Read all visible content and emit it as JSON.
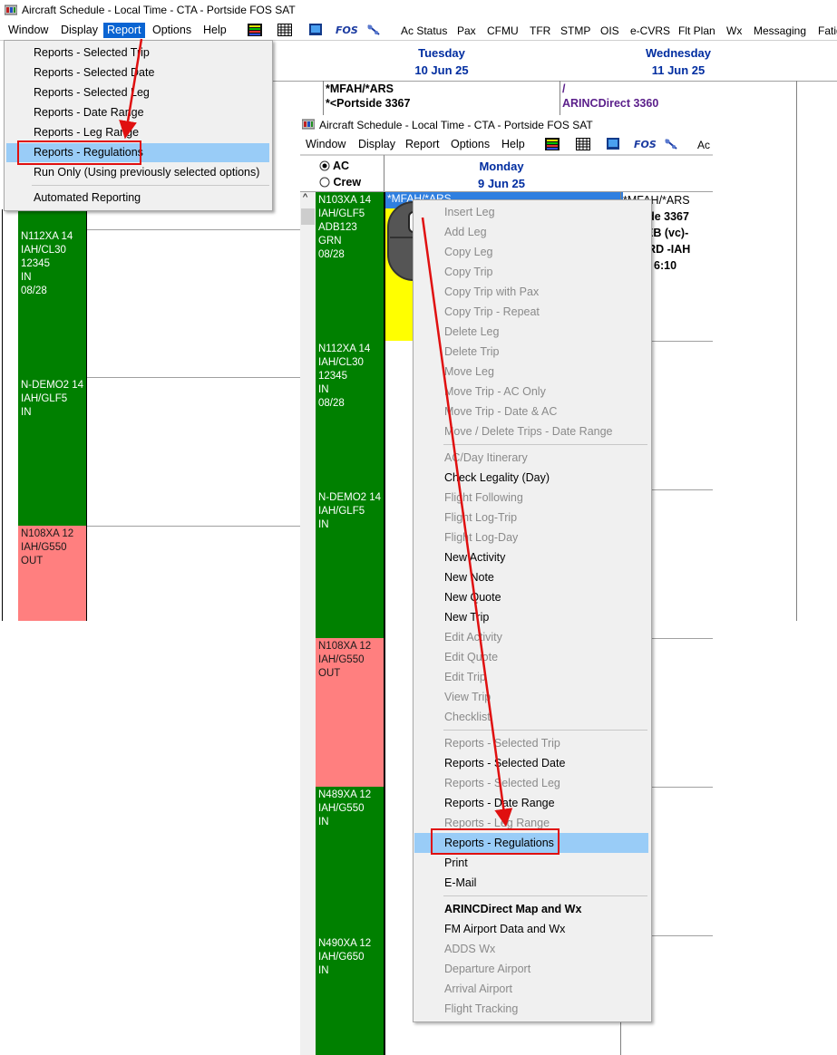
{
  "window": {
    "title": "Aircraft Schedule - Local Time - CTA - Portside FOS SAT"
  },
  "menubar": {
    "items": [
      "Window",
      "Display",
      "Report",
      "Options",
      "Help"
    ],
    "fos_label": "FOS",
    "toolbar_items": [
      "Ac Status",
      "Pax",
      "CFMU",
      "TFR",
      "STMP",
      "OIS",
      "e-CVRS",
      "Flt Plan",
      "Wx",
      "Messaging",
      "Fatig"
    ]
  },
  "schedule": {
    "days": [
      {
        "day": "Tuesday",
        "date": "10 Jun 25"
      },
      {
        "day": "Wednesday",
        "date": "11 Jun 25"
      }
    ],
    "trip_row": {
      "cell1_line1": "*MFAH/*ARS",
      "cell1_line2": "*<Portside 3367",
      "cell2_line1": "/",
      "cell2_line2": "ARINCDirect 3360"
    },
    "aircraft": [
      {
        "text": "N112XA 14\nIAH/CL30\n12345\nIN\n08/28"
      },
      {
        "text": "N-DEMO2 14\nIAH/GLF5\nIN"
      },
      {
        "text": "N108XA 12\nIAH/G550\nOUT"
      }
    ]
  },
  "report_menu": {
    "items": [
      "Reports - Selected Trip",
      "Reports - Selected Date",
      "Reports - Selected Leg",
      "Reports - Date Range",
      "Reports - Leg Range",
      "Reports - Regulations",
      "Run Only (Using previously selected options)",
      "Automated Reporting"
    ],
    "highlighted": "Reports - Regulations"
  },
  "inner_window": {
    "title": "Aircraft Schedule - Local Time - CTA - Portside FOS SAT",
    "menu": [
      "Window",
      "Display",
      "Report",
      "Options",
      "Help"
    ],
    "fos_label": "FOS",
    "partial_item": "Ac",
    "radio_ac": "AC",
    "radio_crew": "Crew",
    "scroll_up": "^",
    "day": "Monday",
    "date": "9 Jun 25",
    "selected_cell": "*MFAH/*ARS",
    "right_lines": [
      "*MFAH/*ARS",
      "ortside 3367",
      "00 TEB (vc)-",
      "26 ORD -IAH",
      "10 Dt 6:10"
    ],
    "aircraft": [
      {
        "text": "N103XA 14\nIAH/GLF5\nADB123\nGRN\n08/28",
        "color": "green"
      },
      {
        "text": "N112XA 14\nIAH/CL30\n12345\nIN\n08/28",
        "color": "green"
      },
      {
        "text": "N-DEMO2 14\nIAH/GLF5\nIN",
        "color": "green"
      },
      {
        "text": "N108XA 12\nIAH/G550\nOUT",
        "color": "red"
      },
      {
        "text": "N489XA 12\nIAH/G550\nIN",
        "color": "green"
      },
      {
        "text": "N490XA 12\nIAH/G650\nIN",
        "color": "green"
      }
    ]
  },
  "context_menu": {
    "items": [
      {
        "label": "Insert Leg",
        "enabled": false
      },
      {
        "label": "Add Leg",
        "enabled": false
      },
      {
        "label": "Copy Leg",
        "enabled": false
      },
      {
        "label": "Copy Trip",
        "enabled": false
      },
      {
        "label": "Copy Trip with Pax",
        "enabled": false
      },
      {
        "label": "Copy Trip - Repeat",
        "enabled": false
      },
      {
        "label": "Delete Leg",
        "enabled": false
      },
      {
        "label": "Delete Trip",
        "enabled": false
      },
      {
        "label": "Move Leg",
        "enabled": false
      },
      {
        "label": "Move Trip - AC Only",
        "enabled": false
      },
      {
        "label": "Move Trip - Date & AC",
        "enabled": false
      },
      {
        "label": "Move / Delete Trips - Date Range",
        "enabled": false
      },
      {
        "label": "AC/Day Itinerary",
        "enabled": false
      },
      {
        "label": "Check Legality (Day)",
        "enabled": true
      },
      {
        "label": "Flight Following",
        "enabled": false
      },
      {
        "label": "Flight Log-Trip",
        "enabled": false
      },
      {
        "label": "Flight Log-Day",
        "enabled": false
      },
      {
        "label": "New Activity",
        "enabled": true
      },
      {
        "label": "New Note",
        "enabled": true
      },
      {
        "label": "New Quote",
        "enabled": true
      },
      {
        "label": "New Trip",
        "enabled": true
      },
      {
        "label": "Edit Activity",
        "enabled": false
      },
      {
        "label": "Edit Quote",
        "enabled": false
      },
      {
        "label": "Edit Trip",
        "enabled": false
      },
      {
        "label": "View Trip",
        "enabled": false
      },
      {
        "label": "Checklist",
        "enabled": false
      },
      {
        "label": "Reports - Selected Trip",
        "enabled": false
      },
      {
        "label": "Reports - Selected Date",
        "enabled": true
      },
      {
        "label": "Reports - Selected Leg",
        "enabled": false
      },
      {
        "label": "Reports - Date Range",
        "enabled": true
      },
      {
        "label": "Reports - Leg Range",
        "enabled": false
      },
      {
        "label": "Reports - Regulations",
        "enabled": true,
        "highlighted": true
      },
      {
        "label": "Print",
        "enabled": true
      },
      {
        "label": "E-Mail",
        "enabled": true
      },
      {
        "label": "ARINCDirect Map and Wx",
        "enabled": true,
        "bold": true
      },
      {
        "label": "FM Airport Data and Wx",
        "enabled": true
      },
      {
        "label": "ADDS Wx",
        "enabled": false
      },
      {
        "label": "Departure Airport",
        "enabled": false
      },
      {
        "label": "Arrival Airport",
        "enabled": false
      },
      {
        "label": "Flight Tracking",
        "enabled": false
      }
    ]
  },
  "colors": {
    "highlight": "#99ccf7",
    "annotation_red": "#e01010",
    "aircraft_green": "#008000",
    "aircraft_out": "#ff7f7f",
    "date_blue": "#002da0",
    "selected_trip": "#ffff00"
  }
}
